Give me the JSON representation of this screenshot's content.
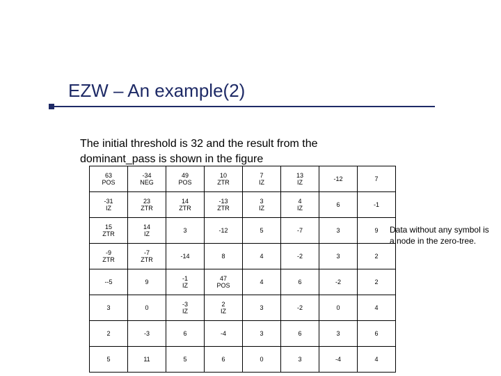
{
  "title": "EZW – An example(2)",
  "intro": "The initial threshold is 32 and the result from the dominant_pass is shown in the figure",
  "note": "Data without any symbol is a node in the zero-tree.",
  "table": [
    [
      "63 POS",
      "-34 NEG",
      "49 POS",
      "10 ZTR",
      "7 IZ",
      "13 IZ",
      "-12",
      "7"
    ],
    [
      "-31 IZ",
      "23 ZTR",
      "14 ZTR",
      "-13 ZTR",
      "3 IZ",
      "4 IZ",
      "6",
      "-1"
    ],
    [
      "15 ZTR",
      "14 IZ",
      "3",
      "-12",
      "5",
      "-7",
      "3",
      "9"
    ],
    [
      "-9 ZTR",
      "-7 ZTR",
      "-14",
      "8",
      "4",
      "-2",
      "3",
      "2"
    ],
    [
      "--5",
      "9",
      "-1 IZ",
      "47 POS",
      "4",
      "6",
      "-2",
      "2"
    ],
    [
      "3",
      "0",
      "-3 IZ",
      "2 IZ",
      "3",
      "-2",
      "0",
      "4"
    ],
    [
      "2",
      "-3",
      "6",
      "-4",
      "3",
      "6",
      "3",
      "6"
    ],
    [
      "5",
      "11",
      "5",
      "6",
      "0",
      "3",
      "-4",
      "4"
    ]
  ]
}
